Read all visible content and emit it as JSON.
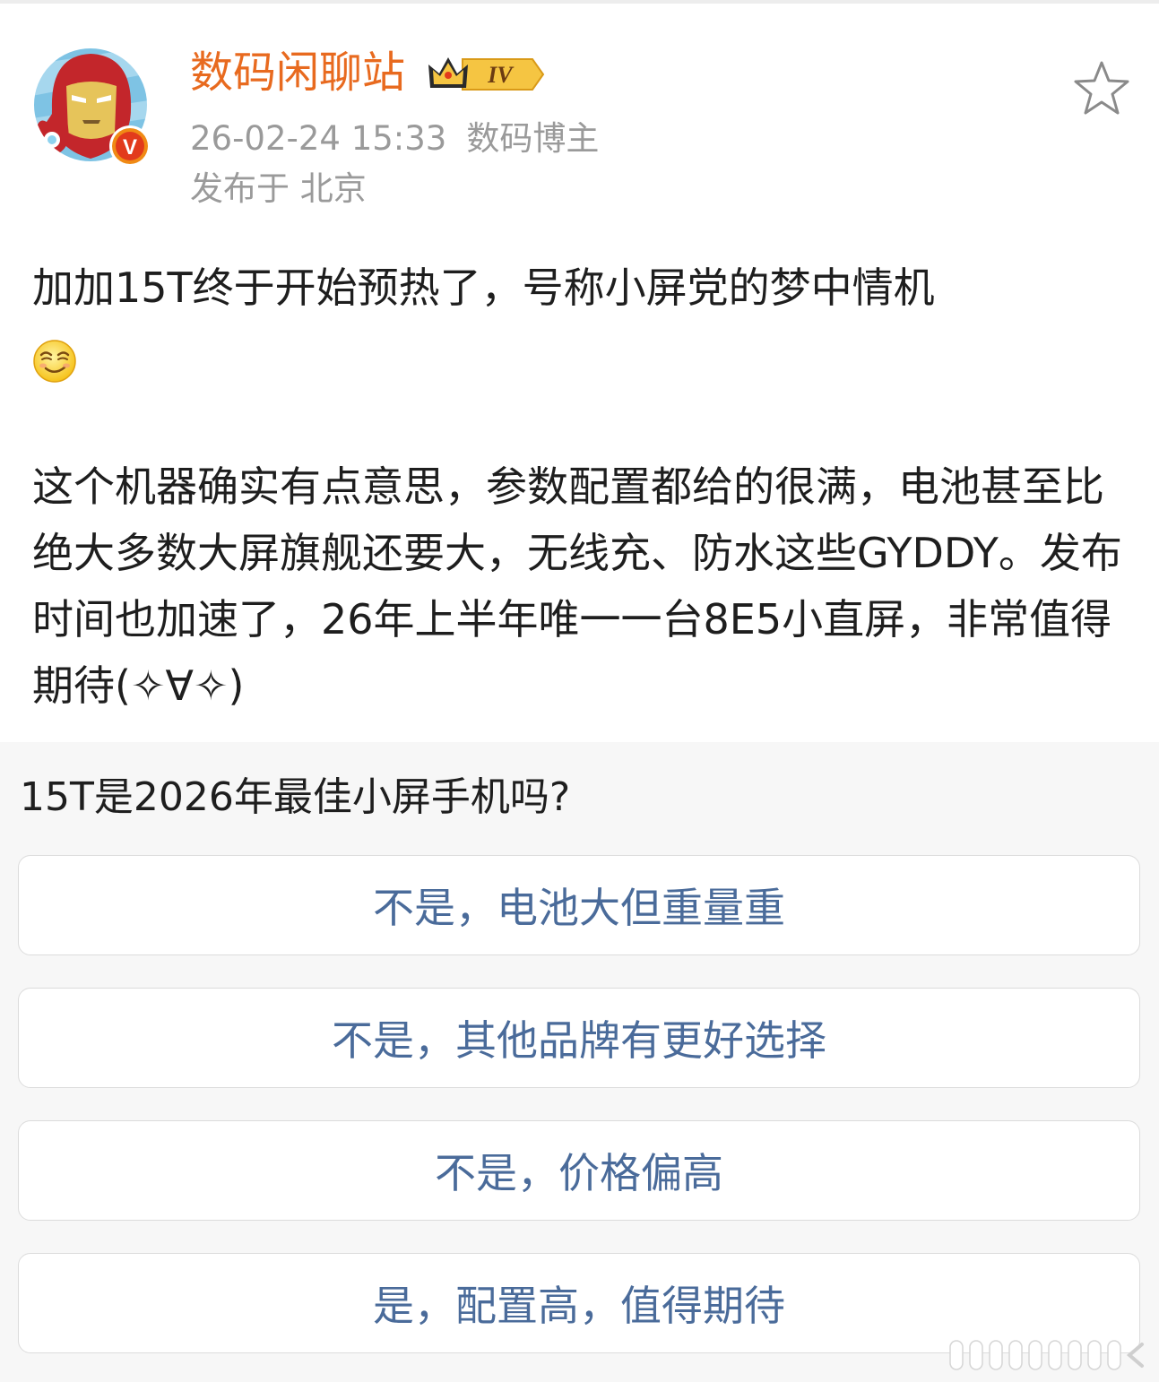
{
  "post": {
    "author": {
      "name": "数码闲聊站",
      "level_badge": "IV",
      "verified_badge": "V",
      "avatar_icon": "iron-man-avatar-icon"
    },
    "timestamp": "26-02-24 15:33",
    "author_role": "数码博主",
    "location": "发布于 北京",
    "paragraph1": "加加15T终于开始预热了，号称小屏党的梦中情机",
    "paragraph1_emoji": "smirk-emoji-icon",
    "paragraph2": "这个机器确实有点意思，参数配置都给的很满，电池甚至比绝大多数大屏旗舰还要大，无线充、防水这些GYDDY。发布时间也加速了，26年上半年唯一一台8E5小直屏，非常值得期待(✧∀✧)"
  },
  "poll": {
    "question": "15T是2026年最佳小屏手机吗?",
    "options": [
      {
        "label": "不是，电池大但重量重"
      },
      {
        "label": "不是，其他品牌有更好选择"
      },
      {
        "label": "不是，价格偏高"
      },
      {
        "label": "是，配置高，值得期待"
      }
    ]
  },
  "colors": {
    "username": "#e86a1f",
    "meta": "#9a9a9a",
    "body_text": "#1e1e1e",
    "poll_option_text": "#4a6b9a",
    "poll_background": "#f7f7f7"
  }
}
